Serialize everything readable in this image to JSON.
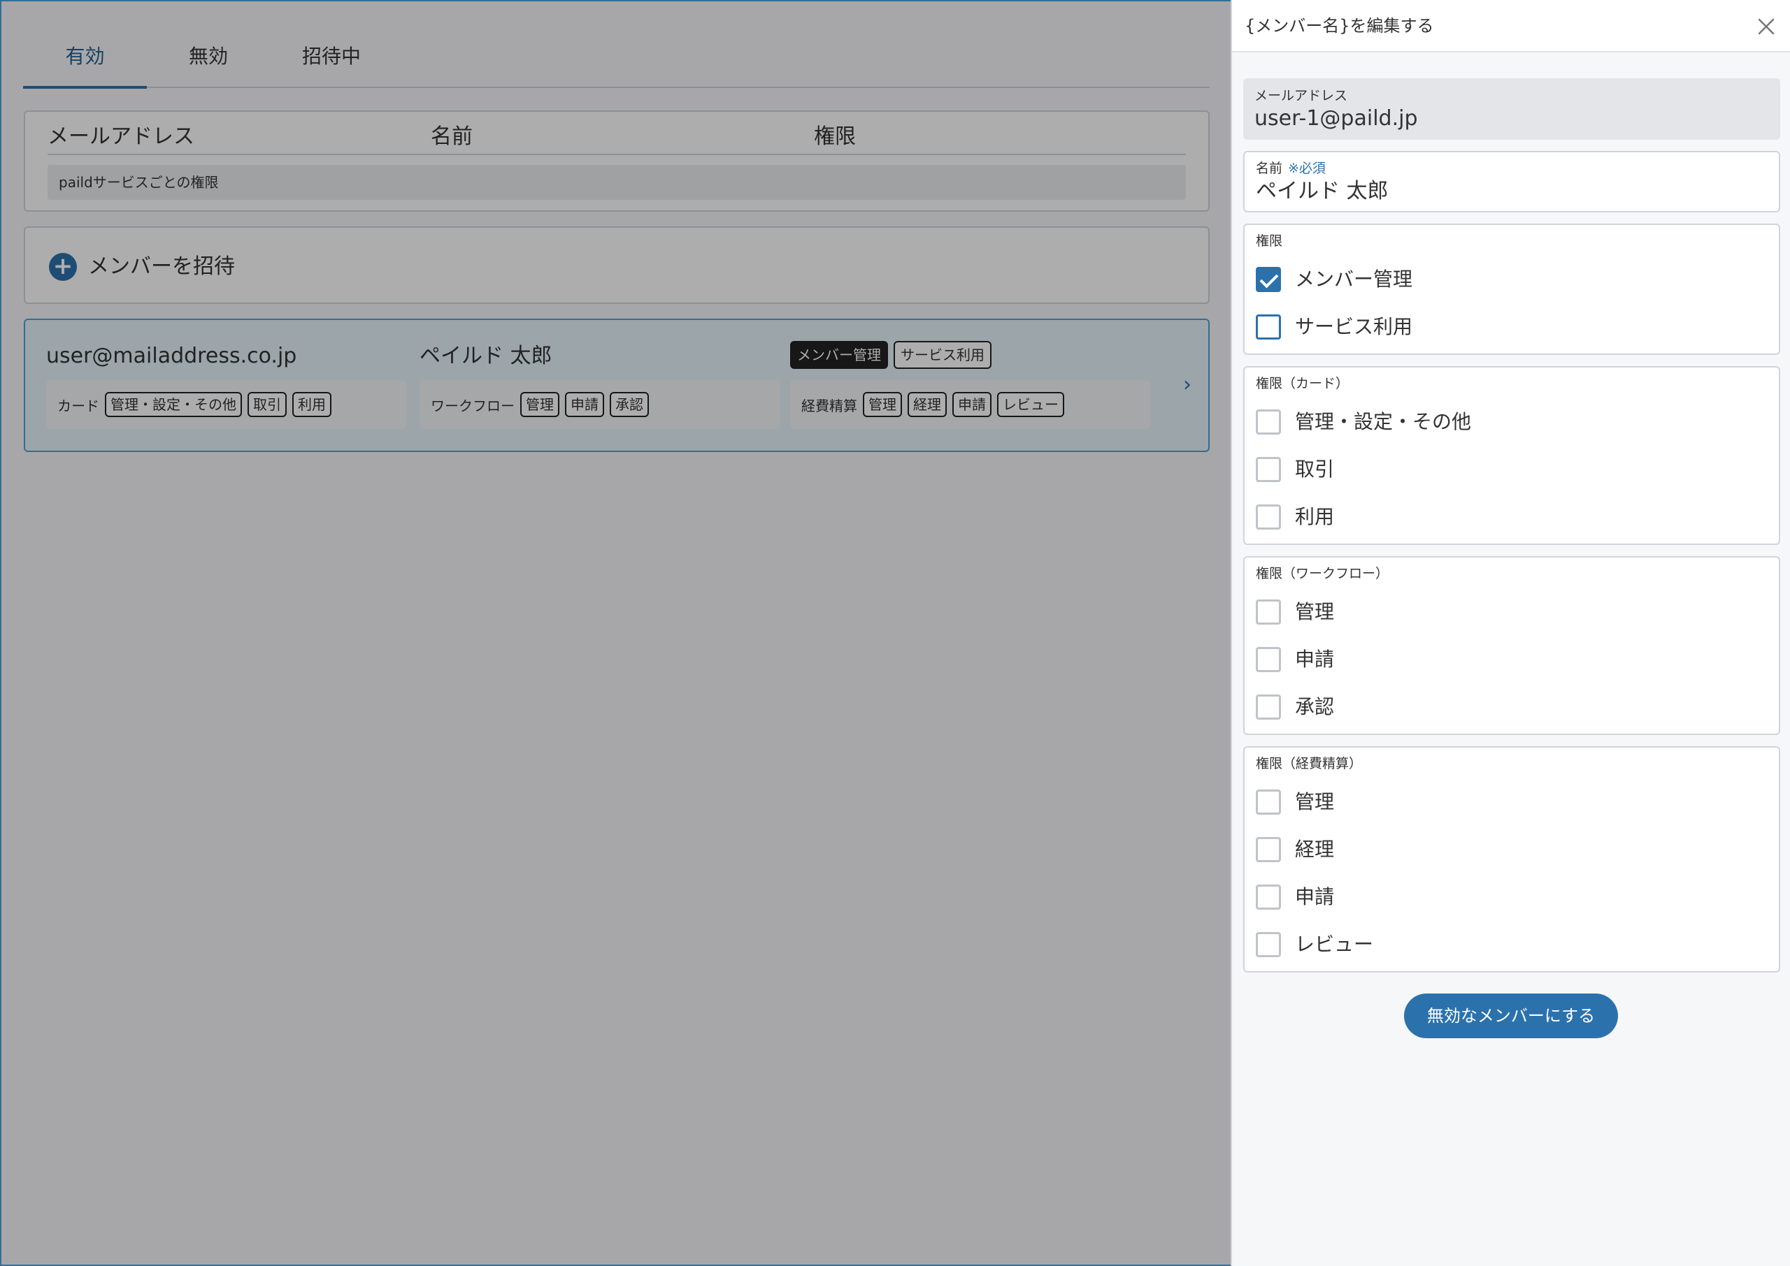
{
  "tabs": [
    {
      "label": "有効"
    },
    {
      "label": "無効"
    },
    {
      "label": "招待中"
    }
  ],
  "table_header": {
    "email": "メールアドレス",
    "name": "名前",
    "permission": "権限",
    "service_permissions": "paildサービスごとの権限"
  },
  "invite": {
    "label": "メンバーを招待"
  },
  "member": {
    "email": "user@mailaddress.co.jp",
    "name": "ペイルド 太郎",
    "roles": [
      "メンバー管理",
      "サービス利用"
    ],
    "card": {
      "label": "カード",
      "chips": [
        "管理・設定・その他",
        "取引",
        "利用"
      ]
    },
    "workflow": {
      "label": "ワークフロー",
      "chips": [
        "管理",
        "申請",
        "承認"
      ]
    },
    "expense": {
      "label": "経費精算",
      "chips": [
        "管理",
        "経理",
        "申請",
        "レビュー"
      ]
    }
  },
  "drawer": {
    "title": "{メンバー名}を編集する",
    "email_label": "メールアドレス",
    "email_value": "user-1@paild.jp",
    "name_label": "名前",
    "required_note": "※必須",
    "name_value": "ペイルド 太郎",
    "permission_group": {
      "label": "権限",
      "items": [
        {
          "label": "メンバー管理",
          "checked": true
        },
        {
          "label": "サービス利用",
          "checked": false
        }
      ]
    },
    "card_group": {
      "label": "権限（カード）",
      "items": [
        {
          "label": "管理・設定・その他",
          "checked": false
        },
        {
          "label": "取引",
          "checked": false
        },
        {
          "label": "利用",
          "checked": false
        }
      ]
    },
    "workflow_group": {
      "label": "権限（ワークフロー）",
      "items": [
        {
          "label": "管理",
          "checked": false
        },
        {
          "label": "申請",
          "checked": false
        },
        {
          "label": "承認",
          "checked": false
        }
      ]
    },
    "expense_group": {
      "label": "権限（経費精算）",
      "items": [
        {
          "label": "管理",
          "checked": false
        },
        {
          "label": "経理",
          "checked": false
        },
        {
          "label": "申請",
          "checked": false
        },
        {
          "label": "レビュー",
          "checked": false
        }
      ]
    },
    "disable_button": "無効なメンバーにする"
  },
  "colors": {
    "accent": "#2b72ad",
    "highlight_border": "#4aa3dc",
    "highlight_bg": "#e5f3fb"
  },
  "icons": [
    "plus-icon",
    "chevron-right-icon",
    "close-icon",
    "check-icon"
  ]
}
